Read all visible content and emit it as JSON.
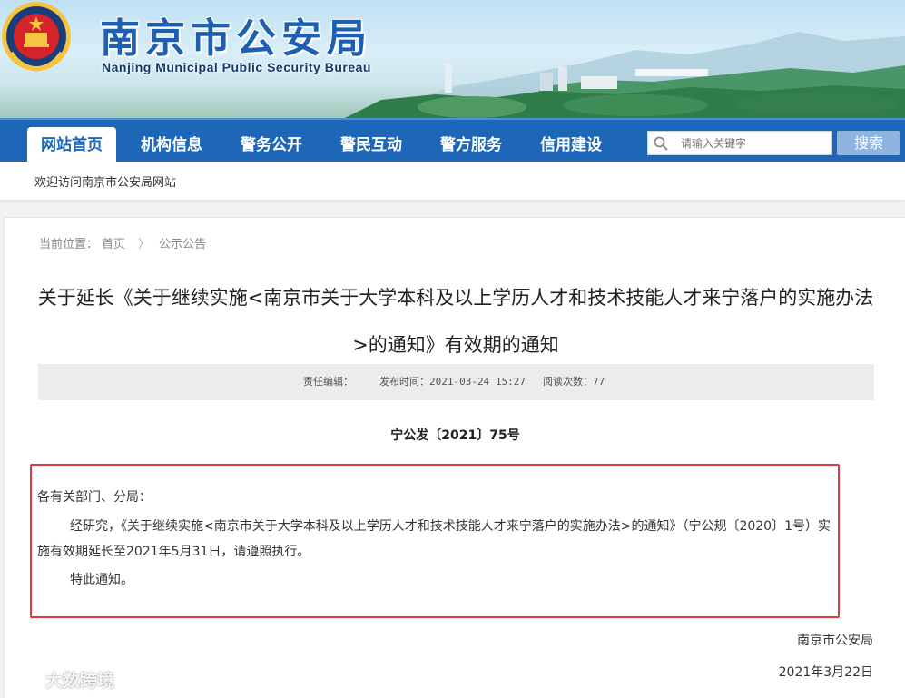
{
  "header": {
    "title": "南京市公安局",
    "subtitle": "Nanjing Municipal Public Security Bureau"
  },
  "nav": {
    "items": [
      {
        "label": "网站首页",
        "active": true
      },
      {
        "label": "机构信息",
        "active": false
      },
      {
        "label": "警务公开",
        "active": false
      },
      {
        "label": "警民互动",
        "active": false
      },
      {
        "label": "警方服务",
        "active": false
      },
      {
        "label": "信用建设",
        "active": false
      }
    ],
    "search_placeholder": "请输入关键字",
    "search_button": "搜索"
  },
  "welcome": "欢迎访问南京市公安局网站",
  "breadcrumb": {
    "prefix": "当前位置：",
    "items": [
      "首页",
      "公示公告"
    ]
  },
  "article": {
    "title": "关于延长《关于继续实施<南京市关于大学本科及以上学历人才和技术技能人才来宁落户的实施办法>的通知》有效期的通知",
    "meta": {
      "editor_label": "责任编辑：",
      "publish_label": "发布时间：2021-03-24 15:27",
      "views_label": "阅读次数：77"
    },
    "doc_number": "宁公发〔2021〕75号",
    "salutation": "各有关部门、分局：",
    "body": "经研究，《关于继续实施<南京市关于大学本科及以上学历人才和技术技能人才来宁落户的实施办法>的通知》（宁公规〔2020〕1号）实施有效期延长至2021年5月31日，请遵照执行。",
    "closing": "特此通知。",
    "signature": "南京市公安局",
    "date": "2021年3月22日"
  },
  "watermark": "大数跨境",
  "colors": {
    "nav_bg": "#1e67b8",
    "title_blue": "#1d5fb1",
    "highlight_border": "#e03b3b"
  }
}
